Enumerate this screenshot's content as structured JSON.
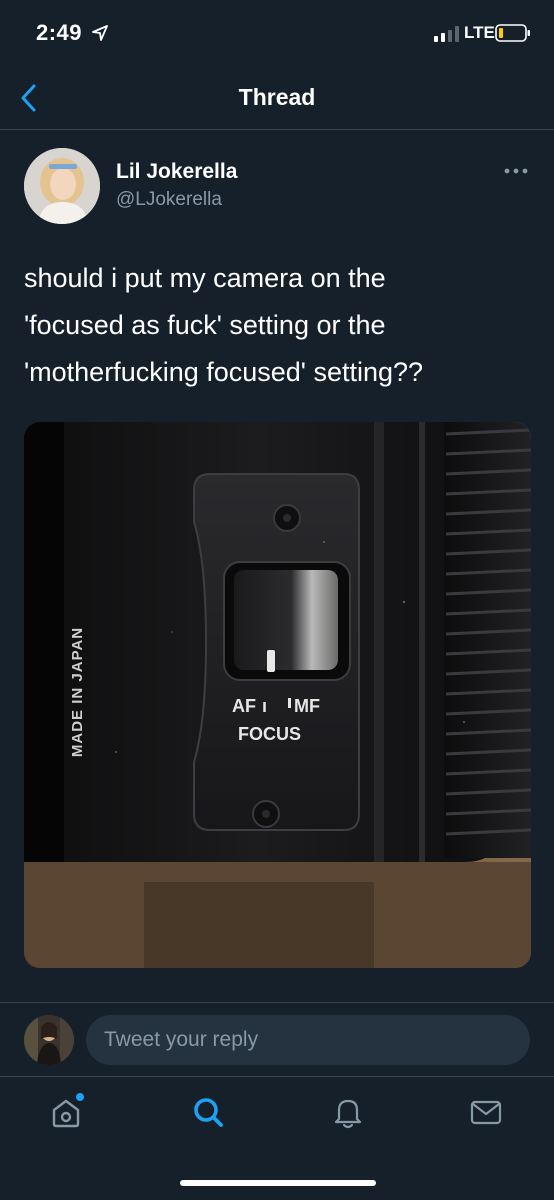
{
  "status_bar": {
    "time": "2:49",
    "network": "LTE"
  },
  "header": {
    "title": "Thread"
  },
  "tweet": {
    "display_name": "Lil Jokerella",
    "handle": "@LJokerella",
    "text_lines": [
      "should i put my camera on the",
      "'focused as fuck' setting or the",
      "'motherfucking focused' setting??"
    ],
    "photo": {
      "lens_text": "MADE IN JAPAN",
      "switch_af": "AF",
      "switch_mf": "MF",
      "switch_label": "FOCUS"
    }
  },
  "reply": {
    "placeholder": "Tweet your reply"
  },
  "tab_bar": {
    "items": [
      "home",
      "search",
      "notifications",
      "messages"
    ]
  },
  "colors": {
    "background": "#15202b",
    "accent": "#1da1f2",
    "muted_text": "#8899a6",
    "divider": "#38444d",
    "input_background": "#253341"
  }
}
